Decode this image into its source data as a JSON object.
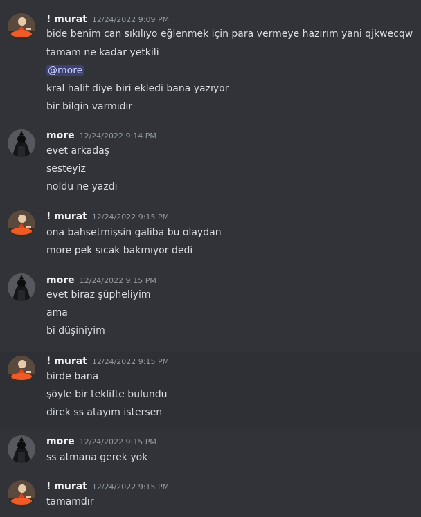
{
  "messages": [
    {
      "user": "! murat",
      "time": "12/24/2022 9:09 PM",
      "avatar_icon": "ballerina-avatar",
      "lines": [
        "bide benim can sıkılıyo eğlenmek için para vermeye hazırım yani qjkwecqw",
        "tamam ne kadar yetkili",
        "@more",
        "kral halit diye biri ekledi bana yazıyor",
        "bir bilgin varmıdır"
      ]
    },
    {
      "user": "more",
      "time": "12/24/2022 9:14 PM",
      "avatar_icon": "dark-knight-avatar",
      "lines": [
        "evet arkadaş",
        "sesteyiz",
        "noldu ne yazdı"
      ]
    },
    {
      "user": "! murat",
      "time": "12/24/2022 9:15 PM",
      "avatar_icon": "ballerina-avatar",
      "lines": [
        "ona bahsetmişsin galiba bu olaydan",
        "more pek sıcak bakmıyor dedi"
      ]
    },
    {
      "user": "more",
      "time": "12/24/2022 9:15 PM",
      "avatar_icon": "dark-knight-avatar",
      "lines": [
        "evet biraz şüpheliyim",
        "ama",
        "bi düşiniyim"
      ]
    },
    {
      "user": "! murat",
      "time": "12/24/2022 9:15 PM",
      "avatar_icon": "ballerina-avatar",
      "lines": [
        "birde bana",
        "şöyle bir teklifte bulundu",
        "direk ss atayım istersen"
      ]
    },
    {
      "user": "more",
      "time": "12/24/2022 9:15 PM",
      "avatar_icon": "dark-knight-avatar",
      "lines": [
        "ss atmana gerek yok"
      ]
    },
    {
      "user": "! murat",
      "time": "12/24/2022 9:15 PM",
      "avatar_icon": "ballerina-avatar",
      "lines": [
        "tamamdır"
      ]
    }
  ],
  "colors": {
    "background": "#313338",
    "hover_background": "#2e3035",
    "username": "#f2f3f5",
    "timestamp": "#949ba4",
    "text": "#dbdee1",
    "mention_bg": "#3c4270",
    "mention_text": "#c9cdfb"
  }
}
